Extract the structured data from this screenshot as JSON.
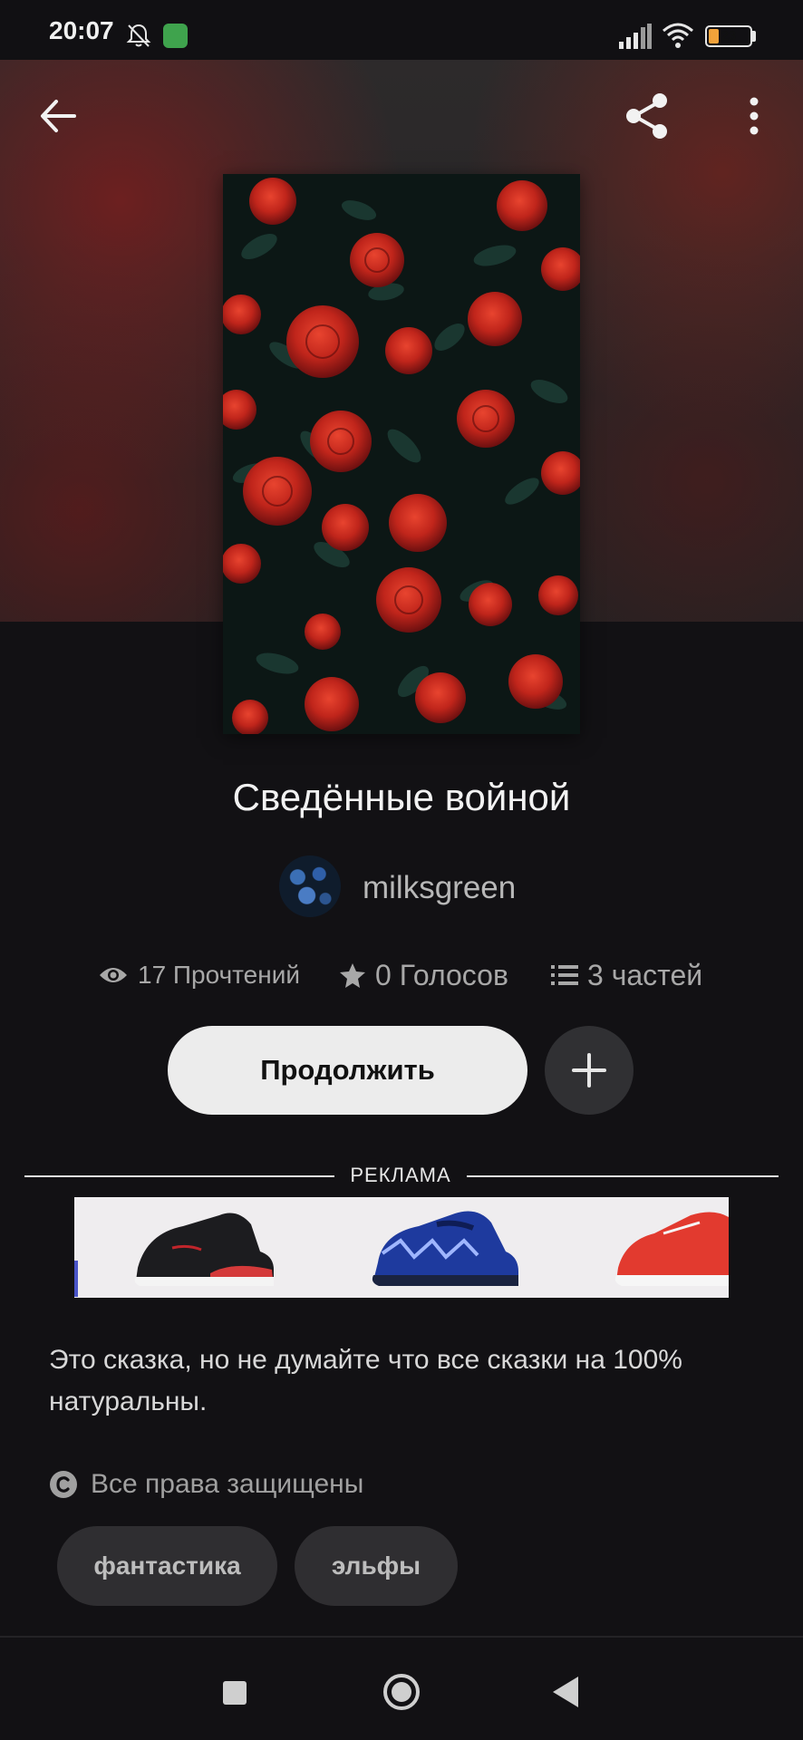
{
  "status_bar": {
    "time": "20:07",
    "battery": "23",
    "icons": [
      "bell-off-icon",
      "app-notification-icon",
      "signal-icon",
      "wifi-icon",
      "battery-icon"
    ]
  },
  "header": {
    "back_icon": "arrow-left-icon",
    "share_icon": "share-icon",
    "more_icon": "more-vertical-icon"
  },
  "story": {
    "title": "Сведённые войной",
    "author": "milksgreen",
    "stats": {
      "reads": "17 Прочтений",
      "votes": "0 Голосов",
      "parts": "3 частей"
    },
    "continue_label": "Продолжить",
    "description": "Это сказка, но не думайте что все сказки на 100% натуральны.",
    "rights": "Все права защищены",
    "tags": [
      "фантастика",
      "эльфы"
    ]
  },
  "ad": {
    "label": "РЕКЛАМА"
  },
  "colors": {
    "background": "#121114",
    "button_light": "#ececec",
    "tag_bg": "#2f2e31",
    "rose_red": "#c0251b"
  }
}
